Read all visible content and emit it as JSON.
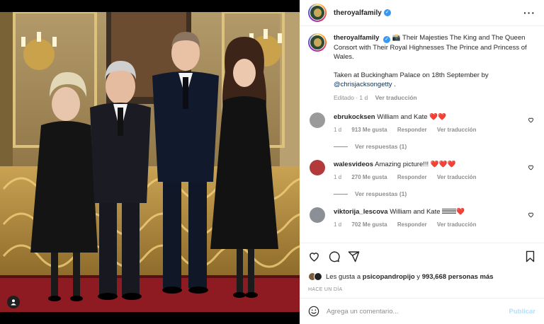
{
  "post": {
    "username": "theroyalfamily",
    "caption_emoji": "📸",
    "caption": "Their Majesties The King and The Queen Consort with Their Royal Highnesses The Prince and Princess of Wales.",
    "caption_line2": "Taken at Buckingham Palace on 18th September by",
    "mention": "@chrisjacksongetty",
    "caption_end": ".",
    "edited": "Editado · 1 d",
    "see_translation": "Ver traducción"
  },
  "comments": [
    {
      "username": "ebrukocksen",
      "text": "William and Kate ",
      "emoji": "❤️❤️",
      "time": "1 d",
      "likes": "913 Me gusta",
      "reply": "Responder",
      "translate": "Ver traducción",
      "view_replies": "Ver respuestas (1)"
    },
    {
      "username": "walesvideos",
      "text": "Amazing picture!!! ",
      "emoji": "❤️❤️❤️",
      "time": "1 d",
      "likes": "270 Me gusta",
      "reply": "Responder",
      "translate": "Ver traducción",
      "view_replies": "Ver respuestas (1)"
    },
    {
      "username": "viktorija_lescova",
      "text": "William and Kate ",
      "emoji": "❤️",
      "time": "1 d",
      "likes": "702 Me gusta",
      "reply": "Responder",
      "translate": "Ver traducción"
    }
  ],
  "likes_line": {
    "prefix": "Les gusta a ",
    "user": "psicopandropijo",
    "middle": " y ",
    "count": "993,668 personas más"
  },
  "time_ago": "HACE UN DÍA",
  "comment_box": {
    "placeholder": "Agrega un comentario...",
    "publish": "Publicar"
  },
  "colors": {
    "verified": "#3897f0",
    "link": "#00376b",
    "muted": "#8e8e8e",
    "publish_disabled": "#b2dffc"
  },
  "icons": [
    "more-icon",
    "heart-icon",
    "comment-icon",
    "share-icon",
    "bookmark-icon",
    "emoji-icon",
    "user-tag-icon",
    "verified-badge-icon",
    "camera-emoji-icon"
  ]
}
